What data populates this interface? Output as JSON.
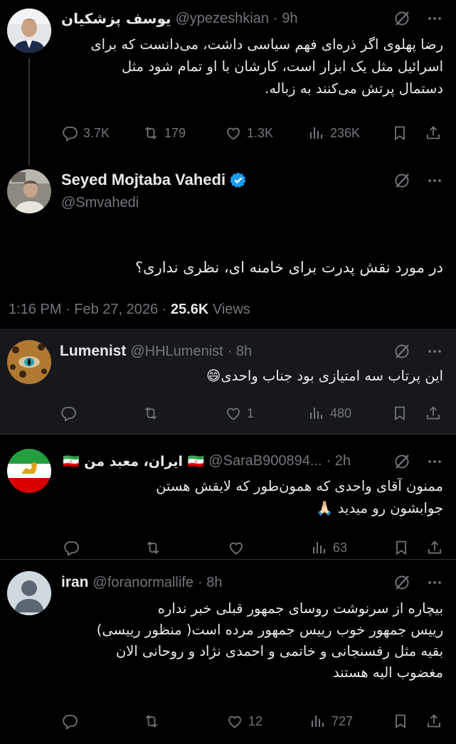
{
  "posts": [
    {
      "name": "یوسف پزشکیان",
      "handle": "@ypezeshkian",
      "time": "· 9h",
      "lines": [
        "رضا پهلوی اگر ذره‌ای فهم سیاسی داشت، می‌دانست که برای",
        "اسرائیل مثل یک ابزار است، کارشان با او تمام شود مثل",
        "دستمال پرتش می‌کنند به زباله."
      ],
      "replies": "3.7K",
      "reposts": "179",
      "likes": "1.3K",
      "views": "236K"
    },
    {
      "name": "Seyed Mojtaba Vahedi",
      "handle": "@Smvahedi",
      "verified": true,
      "text": "در مورد نقش پدرت برای خامنه ای، نظری نداری؟",
      "time_full": "1:16 PM · Feb 27, 2026 · ",
      "views_count": "25.6K",
      "views_label": " Views"
    },
    {
      "name": "Lumenist",
      "handle": "@HHLumenist",
      "time": "· 8h",
      "text": "این پرتاب سه امتیازی بود جناب واحدی😄",
      "replies": "",
      "reposts": "",
      "likes": "1",
      "views": "480"
    },
    {
      "name": "🇮🇷 ایران، معبد من 🇮🇷",
      "handle": "@SaraB900894...",
      "time": "· 2h",
      "lines": [
        "ممنون آقای واحدی که همون‌طور که لایقش هستن",
        "جوابشون رو میدید 🙏🏻"
      ],
      "replies": "",
      "reposts": "",
      "likes": "",
      "views": "63"
    },
    {
      "name": "iran",
      "handle": "@foranormallife",
      "time": "· 8h",
      "lines": [
        "بیچاره از سرنوشت روسای جمهور قبلی خبر نداره",
        "رییس جمهور خوب رییس جمهور مرده است( منظور رییسی)",
        "بقیه مثل رفسنجانی و خاتمی و احمدی نژاد و روحانی الان",
        "مغضوب الیه هستند"
      ],
      "replies": "",
      "reposts": "",
      "likes": "12",
      "views": "727"
    }
  ],
  "icons": [
    "grok-icon",
    "more-icon",
    "reply-icon",
    "repost-icon",
    "like-icon",
    "views-icon",
    "bookmark-icon",
    "share-icon",
    "verified-badge-icon"
  ],
  "colors": {
    "background": "#000000",
    "text": "#e7e9ea",
    "muted": "#71767b",
    "verified": "#1d9bf0",
    "highlight": "#16181c"
  }
}
